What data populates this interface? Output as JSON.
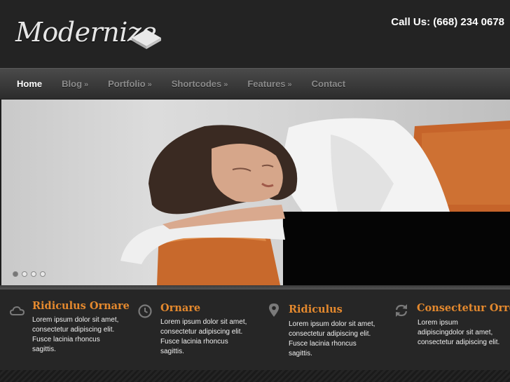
{
  "header": {
    "logo_text": "Modernize",
    "phone": "Call Us: (668) 234 0678"
  },
  "nav": {
    "items": [
      {
        "label": "Home",
        "has_submenu": false,
        "active": true
      },
      {
        "label": "Blog",
        "has_submenu": true,
        "arrow": "»"
      },
      {
        "label": "Portfolio",
        "has_submenu": true,
        "arrow": "»"
      },
      {
        "label": "Shortcodes",
        "has_submenu": true,
        "arrow": "»"
      },
      {
        "label": "Features",
        "has_submenu": true,
        "arrow": "»"
      },
      {
        "label": "Contact",
        "has_submenu": false
      }
    ]
  },
  "slider": {
    "slide_count": 4,
    "active_slide": 1
  },
  "features": [
    {
      "icon": "cloud-icon",
      "title": "Ridiculus Ornare",
      "text": "Lorem ipsum dolor sit amet, consectetur adipiscing elit. Fusce lacinia rhoncus sagittis."
    },
    {
      "icon": "clock-icon",
      "title": "Ornare",
      "text": "Lorem ipsum dolor sit amet, consectetur adipiscing elit. Fusce lacinia rhoncus sagittis."
    },
    {
      "icon": "map-pin-icon",
      "title": "Ridiculus",
      "text": "Lorem ipsum dolor sit amet, consectetur adipiscing elit. Fusce lacinia rhoncus sagittis."
    },
    {
      "icon": "refresh-icon",
      "title": "Consectetur Orre",
      "text": "Lorem ipsum adipiscingdolor sit amet, consectetur adipiscing elit."
    }
  ],
  "colors": {
    "accent": "#e4892e",
    "background": "#1e1e1e",
    "nav_text": "#8a8a8a"
  }
}
